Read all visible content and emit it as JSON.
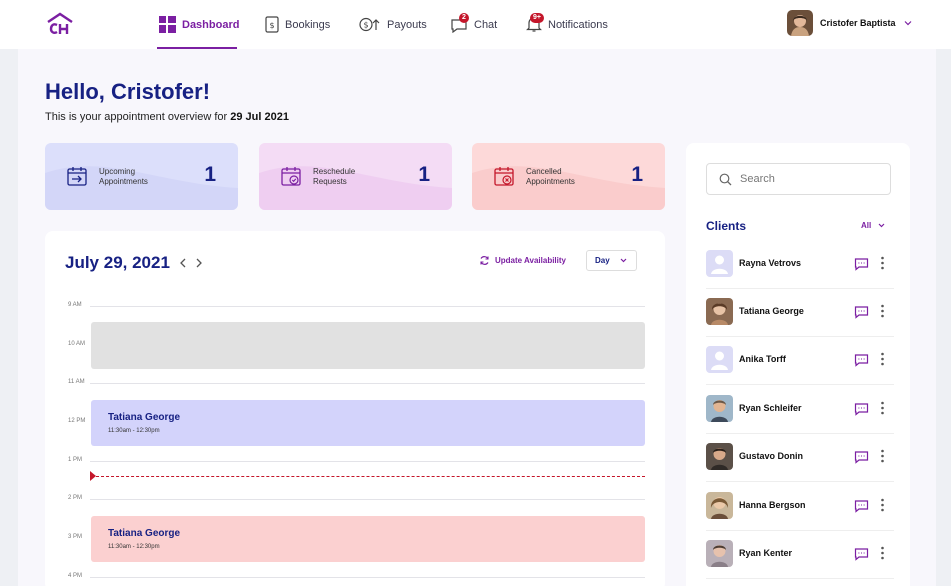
{
  "nav": {
    "items": [
      {
        "label": "Dashboard",
        "icon": "dashboard-icon",
        "active": true
      },
      {
        "label": "Bookings",
        "icon": "bookings-icon"
      },
      {
        "label": "Payouts",
        "icon": "payouts-icon"
      },
      {
        "label": "Chat",
        "icon": "chat-icon",
        "badge": "2"
      },
      {
        "label": "Notifications",
        "icon": "bell-icon",
        "badge": "9+"
      }
    ],
    "user_name": "Cristofer Baptista"
  },
  "greeting": {
    "title": "Hello, Cristofer!",
    "subtitle_prefix": "This is your appointment overview for",
    "date": "29 Jul 2021"
  },
  "stats": [
    {
      "label": "Upcoming Appointments",
      "value": "1",
      "color": "#d9dcfb"
    },
    {
      "label": "Reschedule Requests",
      "value": "1",
      "color": "#f2d7f4"
    },
    {
      "label": "Cancelled Appointments",
      "value": "1",
      "color": "#fcd6d6"
    }
  ],
  "calendar": {
    "date": "July 29, 2021",
    "update_label": "Update Availability",
    "view": "Day",
    "hours": [
      "9 AM",
      "10 AM",
      "11 AM",
      "12 PM",
      "1 PM",
      "2 PM",
      "3 PM",
      "4 PM"
    ],
    "events": [
      {
        "title": "",
        "time": "",
        "color": "#e1e1e1"
      },
      {
        "title": "Tatiana George",
        "time": "11:30am - 12:30pm",
        "color": "#d3d3fb"
      },
      {
        "title": "Tatiana George",
        "time": "11:30am - 12:30pm",
        "color": "#fbd0d0"
      }
    ]
  },
  "clients": {
    "search_placeholder": "Search",
    "title": "Clients",
    "filter": "All",
    "list": [
      {
        "name": "Rayna Vetrovs",
        "avatar": "placeholder"
      },
      {
        "name": "Tatiana George",
        "avatar": "photo"
      },
      {
        "name": "Anika Torff",
        "avatar": "placeholder"
      },
      {
        "name": "Ryan Schleifer",
        "avatar": "photo"
      },
      {
        "name": "Gustavo Donin",
        "avatar": "photo"
      },
      {
        "name": "Hanna Bergson",
        "avatar": "photo"
      },
      {
        "name": "Ryan Kenter",
        "avatar": "photo"
      }
    ]
  },
  "colors": {
    "accent": "#7b1fa2",
    "navy": "#172183",
    "alert": "#c4162a"
  }
}
